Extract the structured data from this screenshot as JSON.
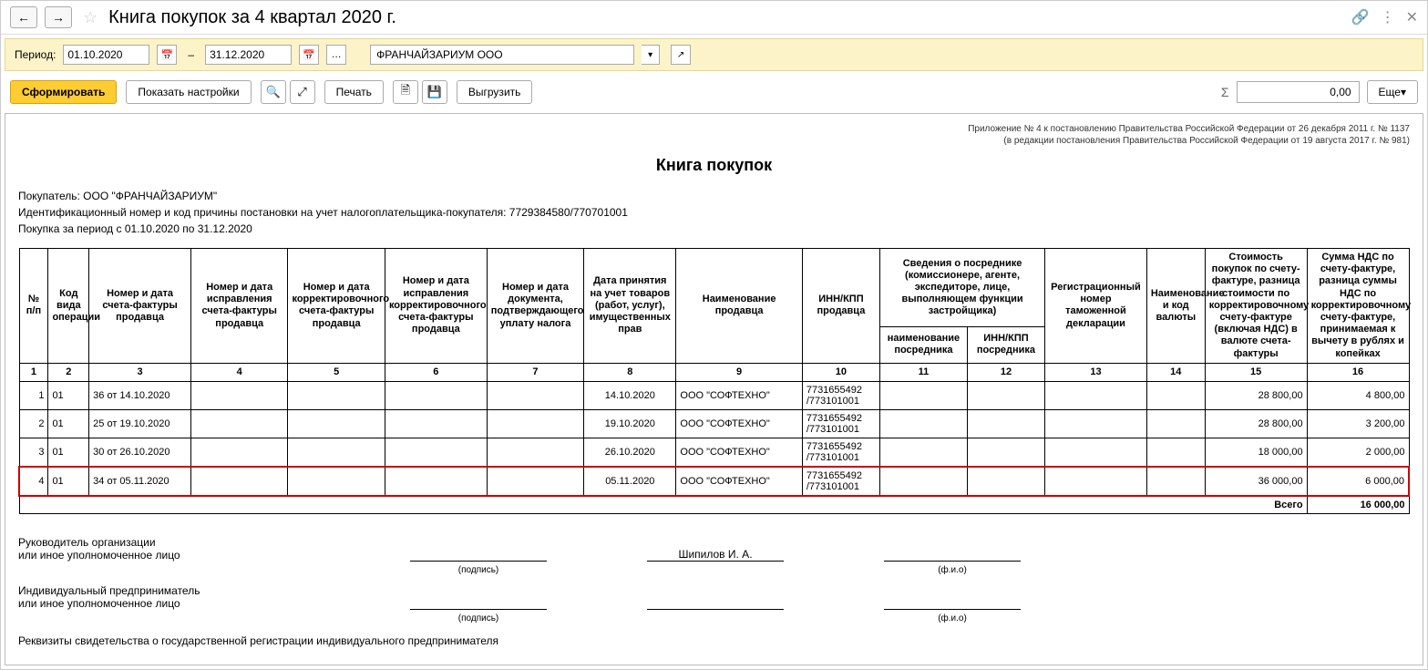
{
  "title": "Книга покупок за 4 квартал 2020 г.",
  "period": {
    "label": "Период:",
    "from": "01.10.2020",
    "to": "31.12.2020",
    "separator": "–"
  },
  "org": {
    "value": "ФРАНЧАЙЗАРИУМ ООО"
  },
  "toolbar": {
    "form": "Сформировать",
    "settings": "Показать настройки",
    "print": "Печать",
    "export": "Выгрузить",
    "more": "Еще"
  },
  "sum_sign": "Σ",
  "sum_value": "0,00",
  "annex": {
    "l1": "Приложение № 4 к постановлению Правительства Российской Федерации от 26 декабря 2011 г. № 1137",
    "l2": "(в редакции постановления Правительства Российской Федерации от 19 августа 2017 г. № 981)"
  },
  "report_title": "Книга покупок",
  "buyer": {
    "name_lbl": "Покупатель:  ООО \"ФРАНЧАЙЗАРИУМ\"",
    "inn_lbl": "Идентификационный номер и код причины постановки на учет налогоплательщика-покупателя:  7729384580/770701001",
    "period_lbl": "Покупка за период с 01.10.2020 по 31.12.2020"
  },
  "headers": {
    "c1": "№ п/п",
    "c2": "Код вида операции",
    "c3": "Номер и дата счета-фактуры продавца",
    "c4": "Номер и дата исправления счета-фактуры продавца",
    "c5": "Номер и дата корректировочного счета-фактуры продавца",
    "c6": "Номер и дата исправления корректировочного счета-фактуры продавца",
    "c7": "Номер и дата документа, подтверждающего уплату налога",
    "c8": "Дата принятия на учет товаров (работ, услуг), имущественных прав",
    "c9": "Наименование продавца",
    "c10": "ИНН/КПП продавца",
    "c11g": "Сведения о посреднике (комиссионере, агенте, экспедиторе, лице, выполняющем функции застройщика)",
    "c11": "наименование посредника",
    "c12": "ИНН/КПП посредника",
    "c13": "Регистрационный номер таможенной декларации",
    "c14": "Наименование и код валюты",
    "c15": "Стоимость покупок по счету-фактуре, разница стоимости по корректировочному счету-фактуре (включая НДС) в валюте счета-фактуры",
    "c16": "Сумма НДС по счету-фактуре, разница суммы НДС по корректировочному счету-фактуре, принимаемая к вычету в рублях и копейках"
  },
  "colnums": [
    "1",
    "2",
    "3",
    "4",
    "5",
    "6",
    "7",
    "8",
    "9",
    "10",
    "11",
    "12",
    "13",
    "14",
    "15",
    "16"
  ],
  "rows": [
    {
      "n": "1",
      "op": "01",
      "sf": "36 от 14.10.2020",
      "date": "14.10.2020",
      "seller": "ООО \"СОФТЕХНО\"",
      "inn": "7731655492 /773101001",
      "cost": "28 800,00",
      "nds": "4 800,00"
    },
    {
      "n": "2",
      "op": "01",
      "sf": "25 от 19.10.2020",
      "date": "19.10.2020",
      "seller": "ООО \"СОФТЕХНО\"",
      "inn": "7731655492 /773101001",
      "cost": "28 800,00",
      "nds": "3 200,00"
    },
    {
      "n": "3",
      "op": "01",
      "sf": "30 от 26.10.2020",
      "date": "26.10.2020",
      "seller": "ООО \"СОФТЕХНО\"",
      "inn": "7731655492 /773101001",
      "cost": "18 000,00",
      "nds": "2 000,00"
    },
    {
      "n": "4",
      "op": "01",
      "sf": "34 от 05.11.2020",
      "date": "05.11.2020",
      "seller": "ООО \"СОФТЕХНО\"",
      "inn": "7731655492 /773101001",
      "cost": "36 000,00",
      "nds": "6 000,00"
    }
  ],
  "total": {
    "label": "Всего",
    "value": "16 000,00"
  },
  "sig": {
    "head1": "Руководитель организации",
    "head2": "или иное уполномоченное лицо",
    "podpis": "(подпись)",
    "fio": "(ф.и.о)",
    "name": "Шипилов И. А.",
    "ip1": "Индивидуальный предприниматель",
    "ip2": "или иное уполномоченное лицо",
    "req": "Реквизиты свидетельства о государственной регистрации индивидуального предпринимателя"
  }
}
